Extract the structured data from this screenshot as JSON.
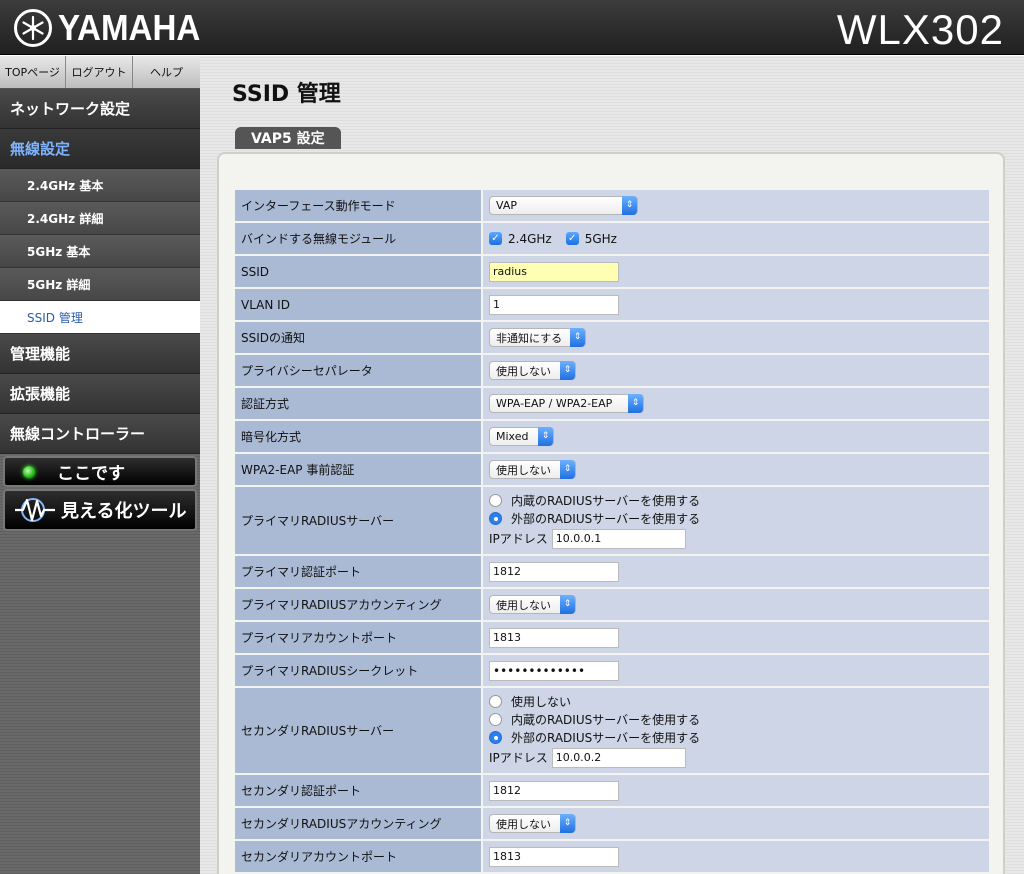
{
  "header": {
    "brand": "YAMAHA",
    "model": "WLX302"
  },
  "toplinks": [
    "TOPページ",
    "ログアウト",
    "ヘルプ"
  ],
  "nav": {
    "network": "ネットワーク設定",
    "wireless": "無線設定",
    "sub": [
      "2.4GHz 基本",
      "2.4GHz 詳細",
      "5GHz 基本",
      "5GHz 詳細",
      "SSID 管理"
    ],
    "management": "管理機能",
    "extensions": "拡張機能",
    "controller": "無線コントローラー",
    "here_button": "ここです",
    "viz_button": "見える化ツール"
  },
  "page_title": "SSID 管理",
  "tab": "VAP5 設定",
  "fields": {
    "mode": {
      "label": "インターフェース動作モード",
      "value": "VAP"
    },
    "bind": {
      "label": "バインドする無線モジュール",
      "opt1": "2.4GHz",
      "opt2": "5GHz",
      "opt1_checked": true,
      "opt2_checked": true
    },
    "ssid": {
      "label": "SSID",
      "value": "radius"
    },
    "vlan": {
      "label": "VLAN ID",
      "value": "1"
    },
    "notify": {
      "label": "SSIDの通知",
      "value": "非通知にする"
    },
    "privacy": {
      "label": "プライバシーセパレータ",
      "value": "使用しない"
    },
    "auth": {
      "label": "認証方式",
      "value": "WPA-EAP / WPA2-EAP"
    },
    "enc": {
      "label": "暗号化方式",
      "value": "Mixed"
    },
    "preauth": {
      "label": "WPA2-EAP 事前認証",
      "value": "使用しない"
    },
    "primary_radius": {
      "label": "プライマリRADIUSサーバー",
      "opt_internal": "内蔵のRADIUSサーバーを使用する",
      "opt_external": "外部のRADIUSサーバーを使用する",
      "selected": "external",
      "ip_label": "IPアドレス",
      "ip": "10.0.0.1"
    },
    "primary_port": {
      "label": "プライマリ認証ポート",
      "value": "1812"
    },
    "primary_acct": {
      "label": "プライマリRADIUSアカウンティング",
      "value": "使用しない"
    },
    "primary_acct_port": {
      "label": "プライマリアカウントポート",
      "value": "1813"
    },
    "primary_secret": {
      "label": "プライマリRADIUSシークレット",
      "value": "•••••••••••••"
    },
    "secondary_radius": {
      "label": "セカンダリRADIUSサーバー",
      "opt_none": "使用しない",
      "opt_internal": "内蔵のRADIUSサーバーを使用する",
      "opt_external": "外部のRADIUSサーバーを使用する",
      "selected": "external",
      "ip_label": "IPアドレス",
      "ip": "10.0.0.2"
    },
    "secondary_port": {
      "label": "セカンダリ認証ポート",
      "value": "1812"
    },
    "secondary_acct": {
      "label": "セカンダリRADIUSアカウンティング",
      "value": "使用しない"
    },
    "secondary_acct_port": {
      "label": "セカンダリアカウントポート",
      "value": "1813"
    }
  },
  "colors": {
    "accent": "#2f7fea",
    "label_bg": "#aab9d4",
    "value_bg": "#cdd5e6",
    "active_nav": "#7eb3ff"
  },
  "icons": {
    "logo": "tuning-fork-emblem-icon",
    "led": "green-led-icon",
    "viz": "waveform-icon",
    "select": "updown-arrow-icon"
  }
}
